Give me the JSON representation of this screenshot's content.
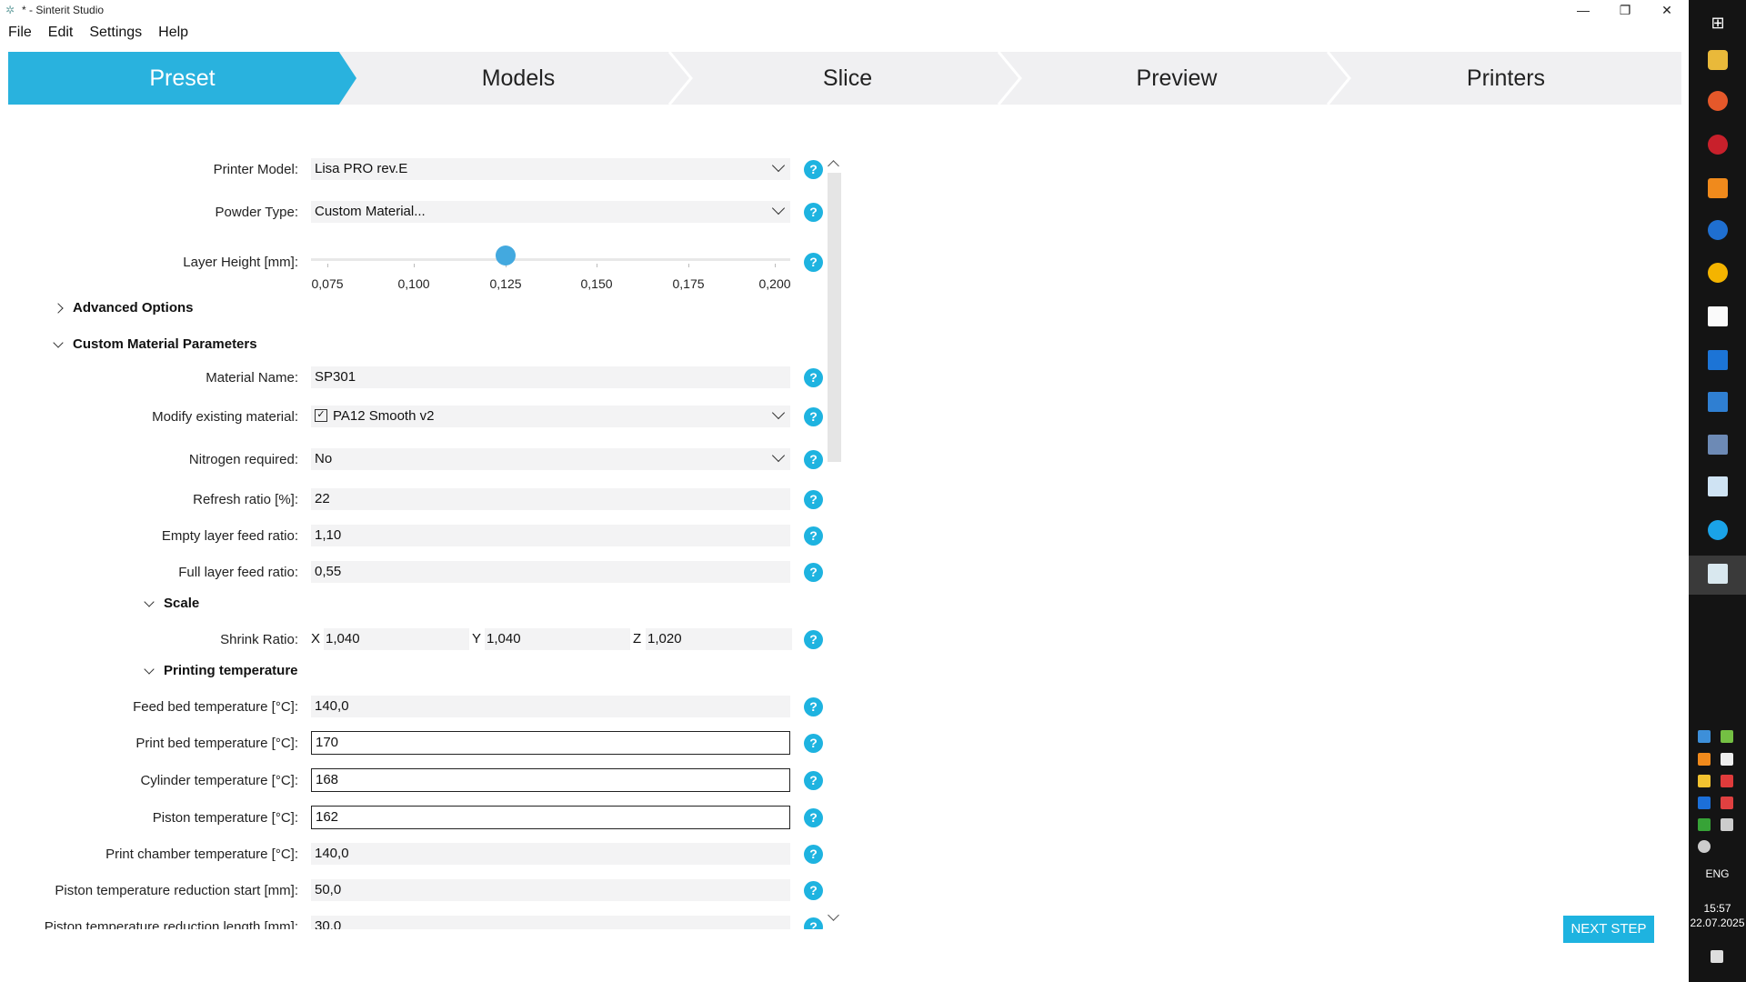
{
  "window": {
    "title": "* - Sinterit Studio",
    "minimize": "—",
    "restore": "❐",
    "close": "✕"
  },
  "menu": [
    "File",
    "Edit",
    "Settings",
    "Help"
  ],
  "steps": [
    "Preset",
    "Models",
    "Slice",
    "Preview",
    "Printers"
  ],
  "form": {
    "printer_model": {
      "label": "Printer Model:",
      "value": "Lisa PRO rev.E"
    },
    "powder_type": {
      "label": "Powder Type:",
      "value": "Custom Material..."
    },
    "layer_height": {
      "label": "Layer Height [mm]:",
      "ticks": [
        "0,075",
        "0,100",
        "0,125",
        "0,150",
        "0,175",
        "0,200"
      ],
      "selected": "0,125"
    },
    "advanced_options": "Advanced Options",
    "custom_material": "Custom Material Parameters",
    "material_name": {
      "label": "Material Name:",
      "value": "SP301"
    },
    "modify_existing": {
      "label": "Modify existing material:",
      "value": "PA12 Smooth v2",
      "checked": true
    },
    "nitrogen": {
      "label": "Nitrogen required:",
      "value": "No"
    },
    "refresh_ratio": {
      "label": "Refresh ratio [%]:",
      "value": "22"
    },
    "empty_layer": {
      "label": "Empty layer feed ratio:",
      "value": "1,10"
    },
    "full_layer": {
      "label": "Full layer feed ratio:",
      "value": "0,55"
    },
    "scale": "Scale",
    "shrink": {
      "label": "Shrink Ratio:",
      "x_label": "X",
      "x": "1,040",
      "y_label": "Y",
      "y": "1,040",
      "z_label": "Z",
      "z": "1,020"
    },
    "printing_temperature": "Printing temperature",
    "feed_bed": {
      "label": "Feed bed temperature [°C]:",
      "value": "140,0"
    },
    "print_bed": {
      "label": "Print bed temperature [°C]:",
      "value": "170"
    },
    "cylinder": {
      "label": "Cylinder temperature [°C]:",
      "value": "168"
    },
    "piston": {
      "label": "Piston temperature [°C]:",
      "value": "162"
    },
    "chamber": {
      "label": "Print chamber temperature [°C]:",
      "value": "140,0"
    },
    "reduction_start": {
      "label": "Piston temperature reduction start [mm]:",
      "value": "50,0"
    },
    "reduction_length": {
      "label": "Piston temperature reduction length [mm]:",
      "value": "30,0"
    },
    "help_glyph": "?"
  },
  "next_step": "NEXT STEP",
  "taskbar": {
    "lang": "ENG",
    "time": "15:57",
    "date": "22.07.2025"
  },
  "colors": {
    "accent": "#29b2de",
    "help": "#1eb3e0",
    "taskbar": "#141414"
  }
}
